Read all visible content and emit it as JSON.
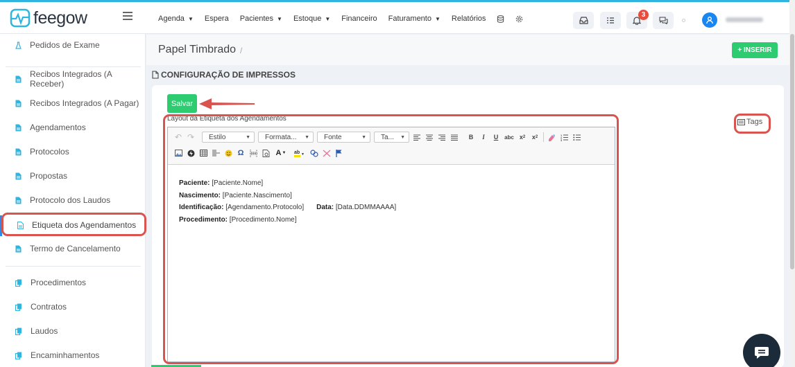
{
  "app": {
    "logo_text": "feegow",
    "brand_color": "#2fb5e0",
    "accent_green": "#2ecc71",
    "highlight_red": "#d9534f"
  },
  "navbar": {
    "menu": [
      {
        "label": "Agenda",
        "dropdown": true
      },
      {
        "label": "Espera",
        "dropdown": false
      },
      {
        "label": "Pacientes",
        "dropdown": true
      },
      {
        "label": "Estoque",
        "dropdown": true
      },
      {
        "label": "Financeiro",
        "dropdown": false
      },
      {
        "label": "Faturamento",
        "dropdown": true
      },
      {
        "label": "Relatórios",
        "dropdown": false
      }
    ],
    "notification_count": "3",
    "icons": [
      "database-icon",
      "settings-icon",
      "inbox-icon",
      "tasks-icon",
      "bell-icon",
      "chat-icon",
      "user-icon"
    ]
  },
  "sidebar": {
    "items": [
      {
        "label": "Pedidos de Exame",
        "icon": "flask-icon"
      },
      {
        "label": "Recibos Integrados (A Receber)",
        "icon": "document-icon"
      },
      {
        "label": "Recibos Integrados (A Pagar)",
        "icon": "document-icon"
      },
      {
        "label": "Agendamentos",
        "icon": "document-icon"
      },
      {
        "label": "Protocolos",
        "icon": "document-icon"
      },
      {
        "label": "Propostas",
        "icon": "document-icon"
      },
      {
        "label": "Protocolo dos Laudos",
        "icon": "document-icon"
      },
      {
        "label": "Etiqueta dos Agendamentos",
        "icon": "document-icon",
        "active": true
      },
      {
        "label": "Termo de Cancelamento",
        "icon": "document-icon"
      },
      {
        "label": "Procedimentos",
        "icon": "copy-icon"
      },
      {
        "label": "Contratos",
        "icon": "copy-icon"
      },
      {
        "label": "Laudos",
        "icon": "copy-icon"
      },
      {
        "label": "Encaminhamentos",
        "icon": "copy-icon"
      }
    ]
  },
  "header": {
    "title": "Papel Timbrado",
    "separator": "/",
    "insert_label": "+ INSERIR"
  },
  "section": {
    "title": "CONFIGURAÇÃO DE IMPRESSOS"
  },
  "form": {
    "save_label": "Salvar",
    "field_label": "Layout da Etiqueta dos Agendamentos",
    "tags_label": "Tags"
  },
  "editor": {
    "combos": {
      "style": "Estilo",
      "format": "Formata...",
      "font": "Fonte",
      "size": "Ta..."
    },
    "content": [
      {
        "label": "Paciente:",
        "value": "[Paciente.Nome]"
      },
      {
        "label": "Nascimento:",
        "value": "[Paciente.Nascimento]"
      },
      {
        "label": "Identificação:",
        "value": "[Agendamento.Protocolo]",
        "label2": "Data:",
        "value2": "[Data.DDMMAAAA]"
      },
      {
        "label": "Procedimento:",
        "value": "[Procedimento.Nome]"
      }
    ]
  }
}
